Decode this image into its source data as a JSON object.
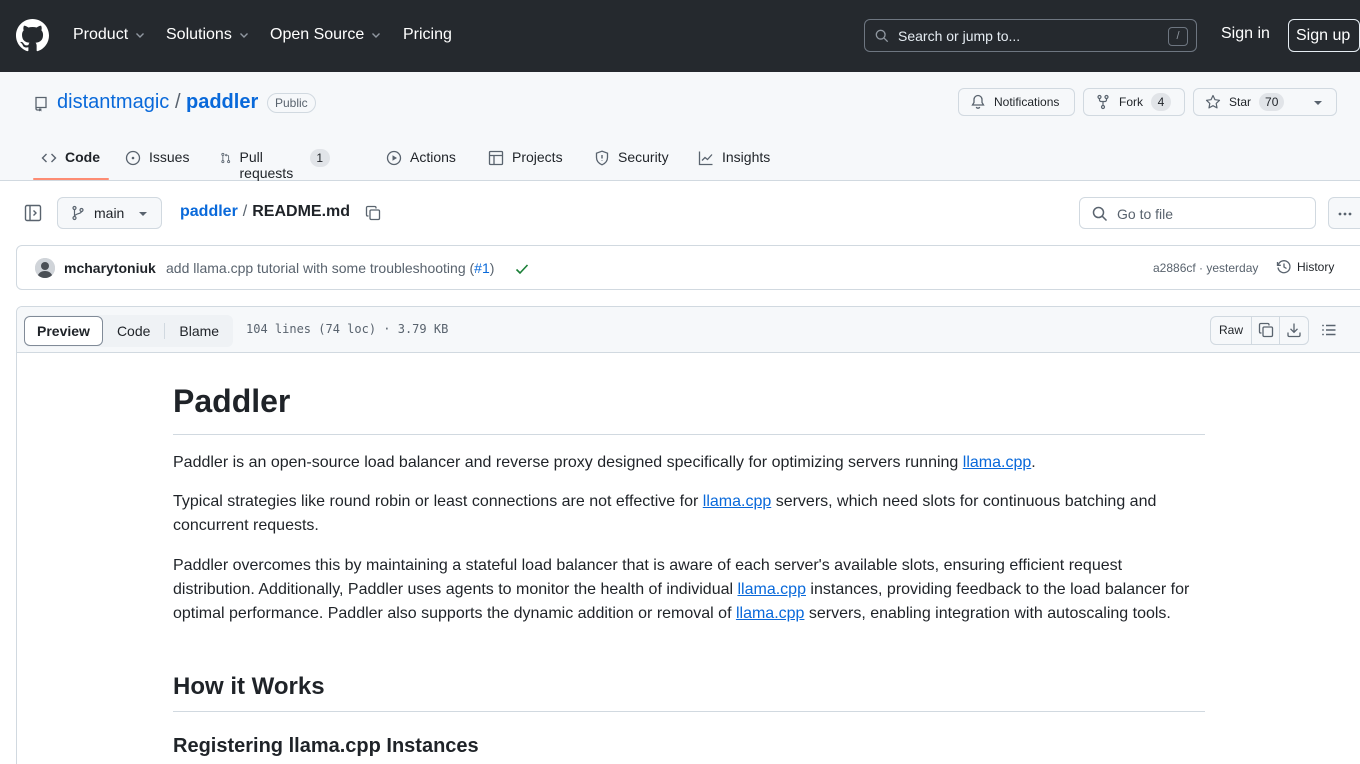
{
  "header": {
    "nav": [
      "Product",
      "Solutions",
      "Open Source",
      "Pricing"
    ],
    "search_placeholder": "Search or jump to...",
    "search_shortcut": "/",
    "sign_in": "Sign in",
    "sign_up": "Sign up"
  },
  "repo": {
    "owner": "distantmagic",
    "separator": "/",
    "name": "paddler",
    "visibility": "Public",
    "notifications_label": "Notifications",
    "fork_label": "Fork",
    "fork_count": "4",
    "star_label": "Star",
    "star_count": "70",
    "tabs": [
      {
        "label": "Code",
        "icon": "code-icon"
      },
      {
        "label": "Issues",
        "icon": "issue-icon"
      },
      {
        "label": "Pull requests",
        "icon": "pull-request-icon",
        "count": "1"
      },
      {
        "label": "Actions",
        "icon": "play-icon"
      },
      {
        "label": "Projects",
        "icon": "table-icon"
      },
      {
        "label": "Security",
        "icon": "shield-icon"
      },
      {
        "label": "Insights",
        "icon": "graph-icon"
      }
    ],
    "active_tab": "Code"
  },
  "file_nav": {
    "branch": "main",
    "breadcrumb_repo": "paddler",
    "breadcrumb_sep": "/",
    "breadcrumb_file": "README.md",
    "goto_placeholder": "Go to file"
  },
  "commit": {
    "author": "mcharytoniuk",
    "message": "add llama.cpp tutorial with some troubleshooting (",
    "pr": "#1",
    "message_end": ")",
    "meta": "a2886cf · yesterday",
    "history_label": "History"
  },
  "file_view": {
    "modes": [
      "Preview",
      "Code",
      "Blame"
    ],
    "active_mode": "Preview",
    "info": "104 lines (74 loc) · 3.79 KB",
    "raw_label": "Raw"
  },
  "readme": {
    "title": "Paddler",
    "p1_text": "Paddler is an open-source load balancer and reverse proxy designed specifically for optimizing servers running ",
    "p1_link": "llama.cpp",
    "p1_end": ".",
    "p2_text": "Typical strategies like round robin or least connections are not effective for ",
    "p2_link": "llama.cpp",
    "p2_end": " servers, which need slots for continuous batching and concurrent requests.",
    "p3_a": "Paddler overcomes this by maintaining a stateful load balancer that is aware of each server's available slots, ensuring efficient request distribution. Additionally, Paddler uses agents to monitor the health of individual ",
    "p3_link1": "llama.cpp",
    "p3_b": " instances, providing feedback to the load balancer for optimal performance. Paddler also supports the dynamic addition or removal of ",
    "p3_link2": "llama.cpp",
    "p3_c": " servers, enabling integration with autoscaling tools.",
    "h2": "How it Works",
    "h3": "Registering llama.cpp Instances"
  },
  "colors": {
    "header_bg": "#25292e",
    "link": "#0969da",
    "active_tab_underline": "#fd8c73",
    "success": "#1a7f37"
  }
}
